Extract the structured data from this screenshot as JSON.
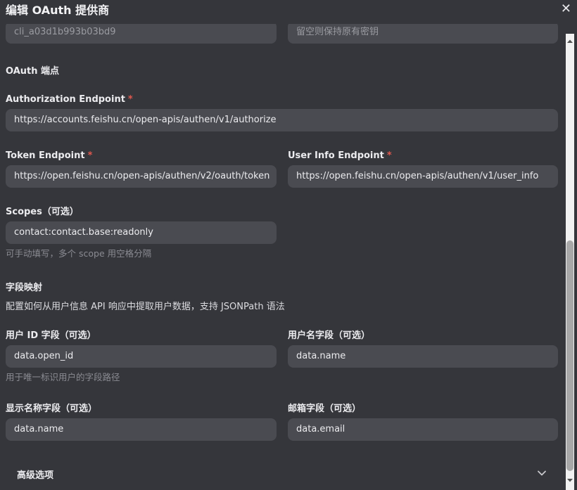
{
  "dialog": {
    "title": "编辑 OAuth 提供商",
    "close_label": "✕"
  },
  "top_partial": {
    "left_value": "cli_a03d1b993b03bd9",
    "right_value": "留空则保持原有密钥"
  },
  "endpoints_section": {
    "title": "OAuth 端点"
  },
  "authorization_endpoint": {
    "label": "Authorization Endpoint",
    "required_mark": "*",
    "value": "https://accounts.feishu.cn/open-apis/authen/v1/authorize"
  },
  "token_endpoint": {
    "label": "Token Endpoint",
    "required_mark": "*",
    "value": "https://open.feishu.cn/open-apis/authen/v2/oauth/token"
  },
  "user_info_endpoint": {
    "label": "User Info Endpoint",
    "required_mark": "*",
    "value": "https://open.feishu.cn/open-apis/authen/v1/user_info"
  },
  "scopes": {
    "label": "Scopes（可选）",
    "value": "contact:contact.base:readonly",
    "hint": "可手动填写，多个 scope 用空格分隔"
  },
  "mapping_section": {
    "title": "字段映射",
    "description": "配置如何从用户信息 API 响应中提取用户数据，支持 JSONPath 语法"
  },
  "user_id_field": {
    "label": "用户 ID 字段（可选）",
    "value": "data.open_id",
    "hint": "用于唯一标识用户的字段路径"
  },
  "username_field": {
    "label": "用户名字段（可选）",
    "value": "data.name"
  },
  "display_name_field": {
    "label": "显示名称字段（可选）",
    "value": "data.name"
  },
  "email_field": {
    "label": "邮箱字段（可选）",
    "value": "data.email"
  },
  "advanced": {
    "label": "高级选项",
    "icon": "chevron-down-icon"
  },
  "colors": {
    "background": "#35363b",
    "input_background": "#4a4b51",
    "required": "#e0584e",
    "hint": "#8a8b92"
  }
}
